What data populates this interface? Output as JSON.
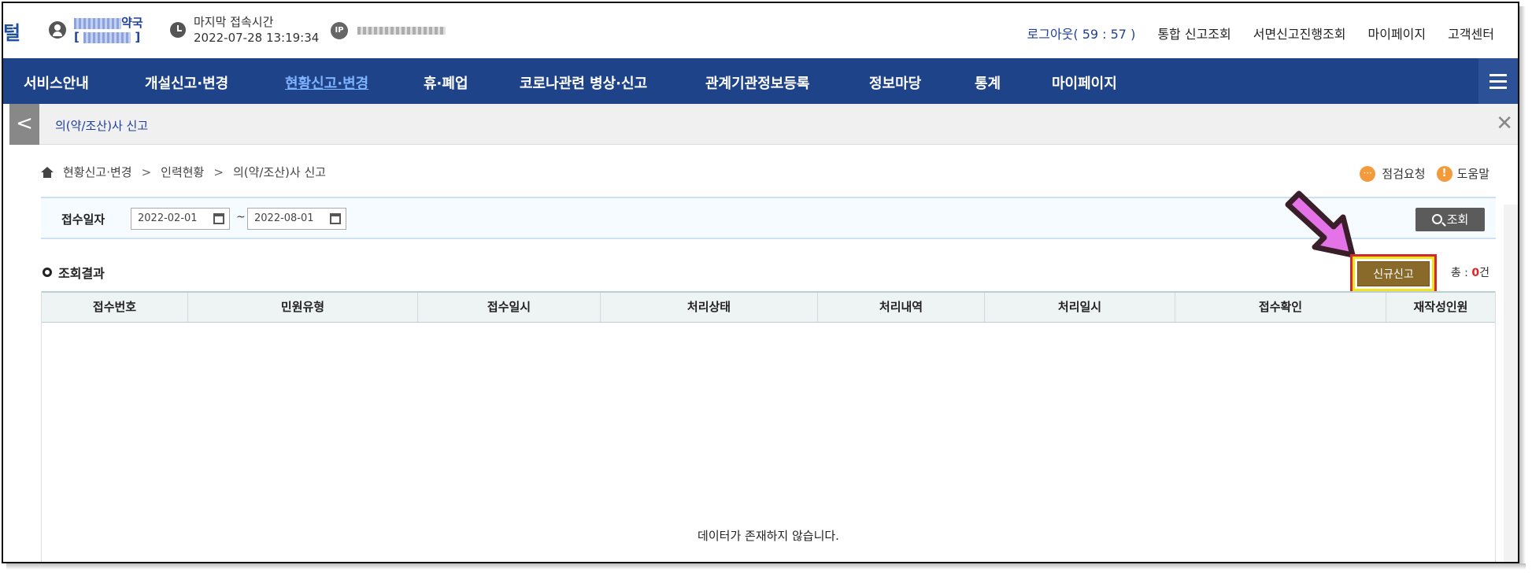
{
  "top": {
    "edge_char": "털",
    "user_name": "약국",
    "user_bracket_open": "[",
    "user_bracket_close": "]",
    "last_access_label": "마지막 접속시간",
    "last_access_time": "2022-07-28 13:19:34",
    "ip_label": "IP",
    "links": [
      "로그아웃( 59 : 57 )",
      "통합 신고조회",
      "서면신고진행조회",
      "마이페이지",
      "고객센터"
    ]
  },
  "nav": {
    "items": [
      "서비스안내",
      "개설신고·변경",
      "현황신고·변경",
      "휴·폐업",
      "코로나관련 병상·신고",
      "관계기관정보등록",
      "정보마당",
      "통계",
      "마이페이지"
    ],
    "active_index": 2
  },
  "subbar": {
    "back_glyph": "<",
    "title": "의(약/조산)사 신고",
    "close_glyph": "✕"
  },
  "breadcrumb": {
    "items": [
      "현황신고·변경",
      "인력현황",
      "의(약/조산)사 신고"
    ],
    "separator": ">"
  },
  "help": {
    "inspect_label": "점검요청",
    "help_label": "도움말",
    "inspect_glyph": "···",
    "help_glyph": "!"
  },
  "search": {
    "label": "접수일자",
    "date_from": "2022-02-01",
    "date_to": "2022-08-01",
    "tilde": "~",
    "button_label": "조회"
  },
  "results": {
    "title": "조회결과",
    "new_button": "신규신고",
    "total_prefix": "총 :",
    "total_count": "0",
    "total_suffix": "건"
  },
  "table": {
    "columns": [
      "접수번호",
      "민원유형",
      "접수일시",
      "처리상태",
      "처리내역",
      "처리일시",
      "접수확인",
      "재작성인원"
    ],
    "empty_message": "데이터가 존재하지 않습니다."
  },
  "colors": {
    "nav_bg": "#1f4388",
    "nav_active": "#7fb2ff",
    "new_button_bg": "#8a6a2b",
    "highlight_border": "#f5e21a",
    "highlight_outline": "#d12a2a",
    "arrow_fill": "#e573e8",
    "total_count": "#e02424"
  }
}
